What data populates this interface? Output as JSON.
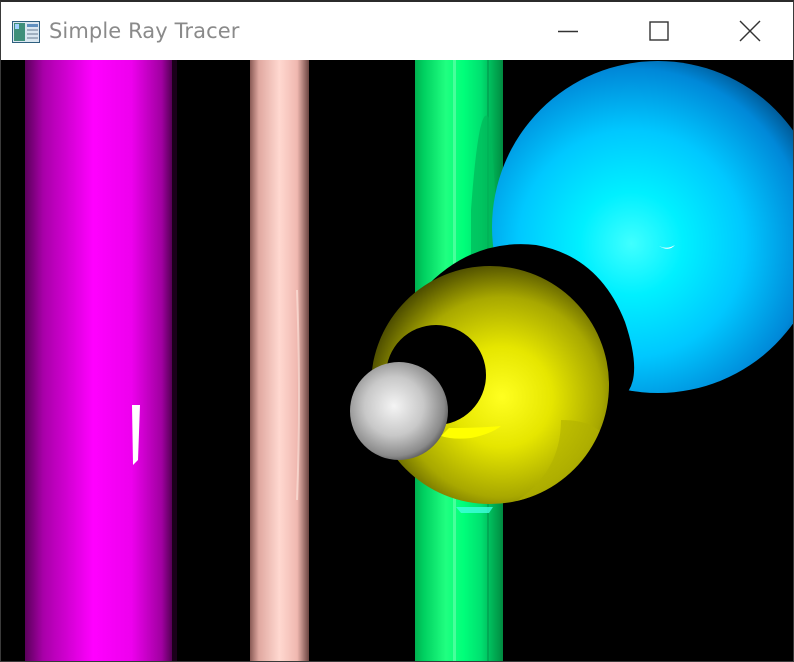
{
  "window": {
    "title": "Simple Ray Tracer",
    "app_icon": "window-app-icon",
    "controls": {
      "minimize_icon": "minimize-icon",
      "maximize_icon": "maximize-icon",
      "close_icon": "close-icon"
    }
  },
  "scene": {
    "background_color": "#000000",
    "objects": [
      {
        "name": "magenta-cylinder",
        "color": "#ff00ff"
      },
      {
        "name": "pink-cylinder",
        "color": "#ffc8c0"
      },
      {
        "name": "green-cylinder",
        "color": "#00ff7a"
      },
      {
        "name": "blue-sphere",
        "color": "#00c8ff"
      },
      {
        "name": "yellow-sphere",
        "color": "#e6e600"
      },
      {
        "name": "white-sphere",
        "color": "#d8d8d8"
      }
    ]
  }
}
